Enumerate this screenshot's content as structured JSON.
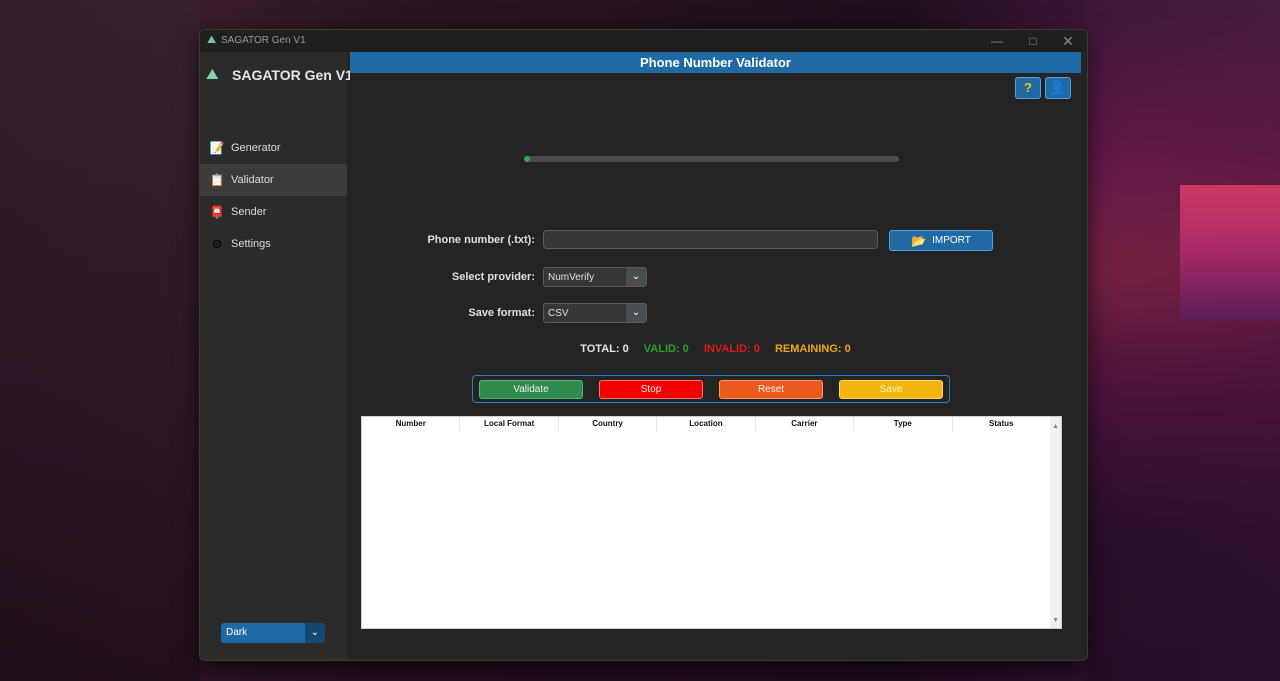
{
  "window": {
    "title": "SAGATOR Gen V1",
    "controls": {
      "minimize": "—",
      "maximize": "□",
      "close": "✕"
    }
  },
  "sidebar": {
    "brand": "SAGATOR Gen V1",
    "items": [
      {
        "label": "Generator",
        "icon": "generator-icon",
        "glyph": "📝"
      },
      {
        "label": "Validator",
        "icon": "validator-icon",
        "glyph": "📋"
      },
      {
        "label": "Sender",
        "icon": "sender-icon",
        "glyph": "📮"
      },
      {
        "label": "Settings",
        "icon": "settings-icon",
        "glyph": "⚙"
      }
    ],
    "theme": {
      "value": "Dark"
    }
  },
  "main": {
    "title": "Phone Number Validator",
    "progress": 0.0,
    "form": {
      "phone_label": "Phone number (.txt):",
      "phone_value": "",
      "import_label": "IMPORT",
      "provider_label": "Select provider:",
      "provider_value": "NumVerify",
      "format_label": "Save format:",
      "format_value": "CSV"
    },
    "stats": {
      "total": "TOTAL: 0",
      "valid": "VALID: 0",
      "invalid": "INVALID: 0",
      "remaining": "REMAINING: 0"
    },
    "actions": {
      "validate": "Validate",
      "stop": "Stop",
      "reset": "Reset",
      "save": "Save"
    },
    "table": {
      "columns": [
        "Number",
        "Local Format",
        "Country",
        "Location",
        "Carrier",
        "Type",
        "Status"
      ],
      "rows": []
    }
  },
  "colors": {
    "accent": "#1f6aa5",
    "valid": "#2fa02f",
    "invalid": "#e01a1a",
    "remaining": "#f0a81a"
  }
}
